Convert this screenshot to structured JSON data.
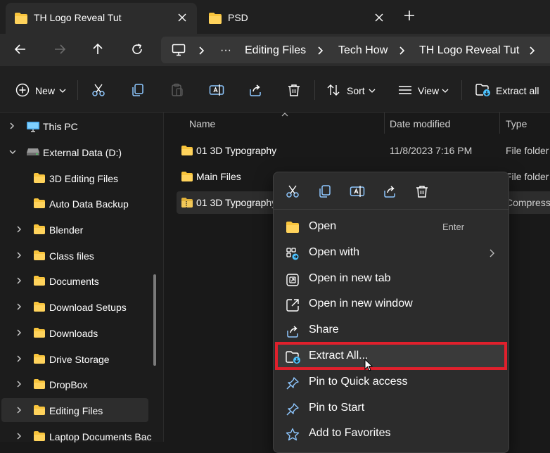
{
  "tabs": [
    {
      "label": "TH Logo Reveal Tut",
      "active": true
    },
    {
      "label": "PSD",
      "active": false
    }
  ],
  "address": {
    "more": "···",
    "crumbs": [
      "Editing Files",
      "Tech How",
      "TH Logo Reveal Tut"
    ]
  },
  "toolbar": {
    "new_label": "New",
    "sort_label": "Sort",
    "view_label": "View",
    "extract_label": "Extract all"
  },
  "sidebar": {
    "items": [
      {
        "label": "This PC",
        "icon": "pc-icon"
      },
      {
        "label": "External Data (D:)",
        "icon": "drive-icon"
      },
      {
        "label": "3D Editing Files",
        "icon": "folder-icon"
      },
      {
        "label": "Auto Data Backup",
        "icon": "folder-icon"
      },
      {
        "label": "Blender",
        "icon": "folder-icon"
      },
      {
        "label": "Class files",
        "icon": "folder-icon"
      },
      {
        "label": "Documents",
        "icon": "folder-icon"
      },
      {
        "label": "Download Setups",
        "icon": "folder-icon"
      },
      {
        "label": "Downloads",
        "icon": "folder-icon"
      },
      {
        "label": "Drive Storage",
        "icon": "folder-icon"
      },
      {
        "label": "DropBox",
        "icon": "folder-icon"
      },
      {
        "label": "Editing Files",
        "icon": "folder-icon",
        "selected": true
      },
      {
        "label": "Laptop Documents Bac",
        "icon": "folder-icon"
      }
    ]
  },
  "filelist": {
    "columns": {
      "name": "Name",
      "date": "Date modified",
      "type": "Type"
    },
    "rows": [
      {
        "name": "01 3D Typography",
        "date": "11/8/2023 7:16 PM",
        "type": "File folder",
        "icon": "folder-icon"
      },
      {
        "name": "Main Files",
        "date": "",
        "type": "File folder",
        "icon": "folder-icon"
      },
      {
        "name": "01 3D Typography",
        "date": "",
        "type": "Compresse",
        "icon": "zip-folder-icon"
      }
    ]
  },
  "context_menu": {
    "items": [
      {
        "label": "Open",
        "shortcut": "Enter",
        "icon": "folder-icon"
      },
      {
        "label": "Open with",
        "icon": "open-with-icon",
        "has_submenu": true
      },
      {
        "label": "Open in new tab",
        "icon": "new-tab-icon"
      },
      {
        "label": "Open in new window",
        "icon": "new-window-icon"
      },
      {
        "label": "Share",
        "icon": "share-icon"
      },
      {
        "label": "Extract All...",
        "icon": "extract-icon",
        "highlighted": true
      },
      {
        "label": "Pin to Quick access",
        "icon": "pin-icon"
      },
      {
        "label": "Pin to Start",
        "icon": "pin-icon"
      },
      {
        "label": "Add to Favorites",
        "icon": "star-icon"
      }
    ]
  },
  "colors": {
    "accent": "#4cc2ff",
    "folder": "#f8c43c",
    "highlight_box": "#e0202c"
  }
}
